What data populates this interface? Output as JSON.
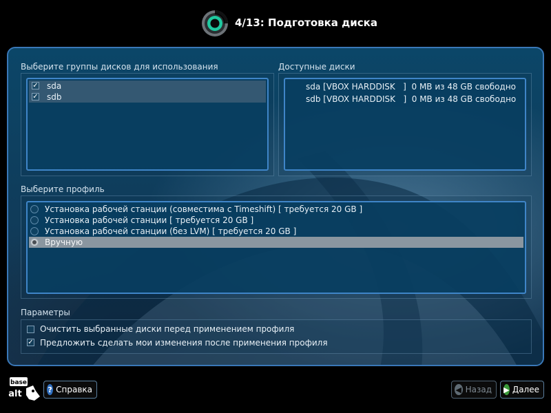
{
  "header": {
    "title": "4/13: Подготовка диска"
  },
  "disk_groups": {
    "label": "Выберите группы дисков для использования",
    "items": [
      {
        "name": "sda",
        "checked": true
      },
      {
        "name": "sdb",
        "checked": true
      }
    ]
  },
  "available_disks": {
    "label": "Доступные диски",
    "items": [
      "sda [VBOX HARDDISK   ]  0 MB из 48 GB свободно",
      "sdb [VBOX HARDDISK   ]  0 MB из 48 GB свободно"
    ]
  },
  "profile": {
    "label": "Выберите профиль",
    "options": [
      {
        "label": "Установка рабочей станции (совместима с Timeshift) [ требуется 20 GB ]",
        "selected": false
      },
      {
        "label": "Установка рабочей станции [ требуется 20 GB ]",
        "selected": false
      },
      {
        "label": "Установка рабочей станции (без LVM) [ требуется 20 GB ]",
        "selected": false
      },
      {
        "label": "Вручную",
        "selected": true
      }
    ]
  },
  "params": {
    "label": "Параметры",
    "clear_disks": {
      "label": "Очистить выбранные диски перед применением профиля",
      "checked": false
    },
    "suggest_changes": {
      "label": "Предложить сделать мои изменения после применения профиля",
      "checked": true
    }
  },
  "footer": {
    "logo_text_top": "base",
    "logo_text_bottom": "alt",
    "help_label": "Справка",
    "back_label": "Назад",
    "next_label": "Далее"
  },
  "colors": {
    "accent": "#3f85c8",
    "ring_green": "#1fc9a0",
    "next_green": "#3a9a3a"
  }
}
